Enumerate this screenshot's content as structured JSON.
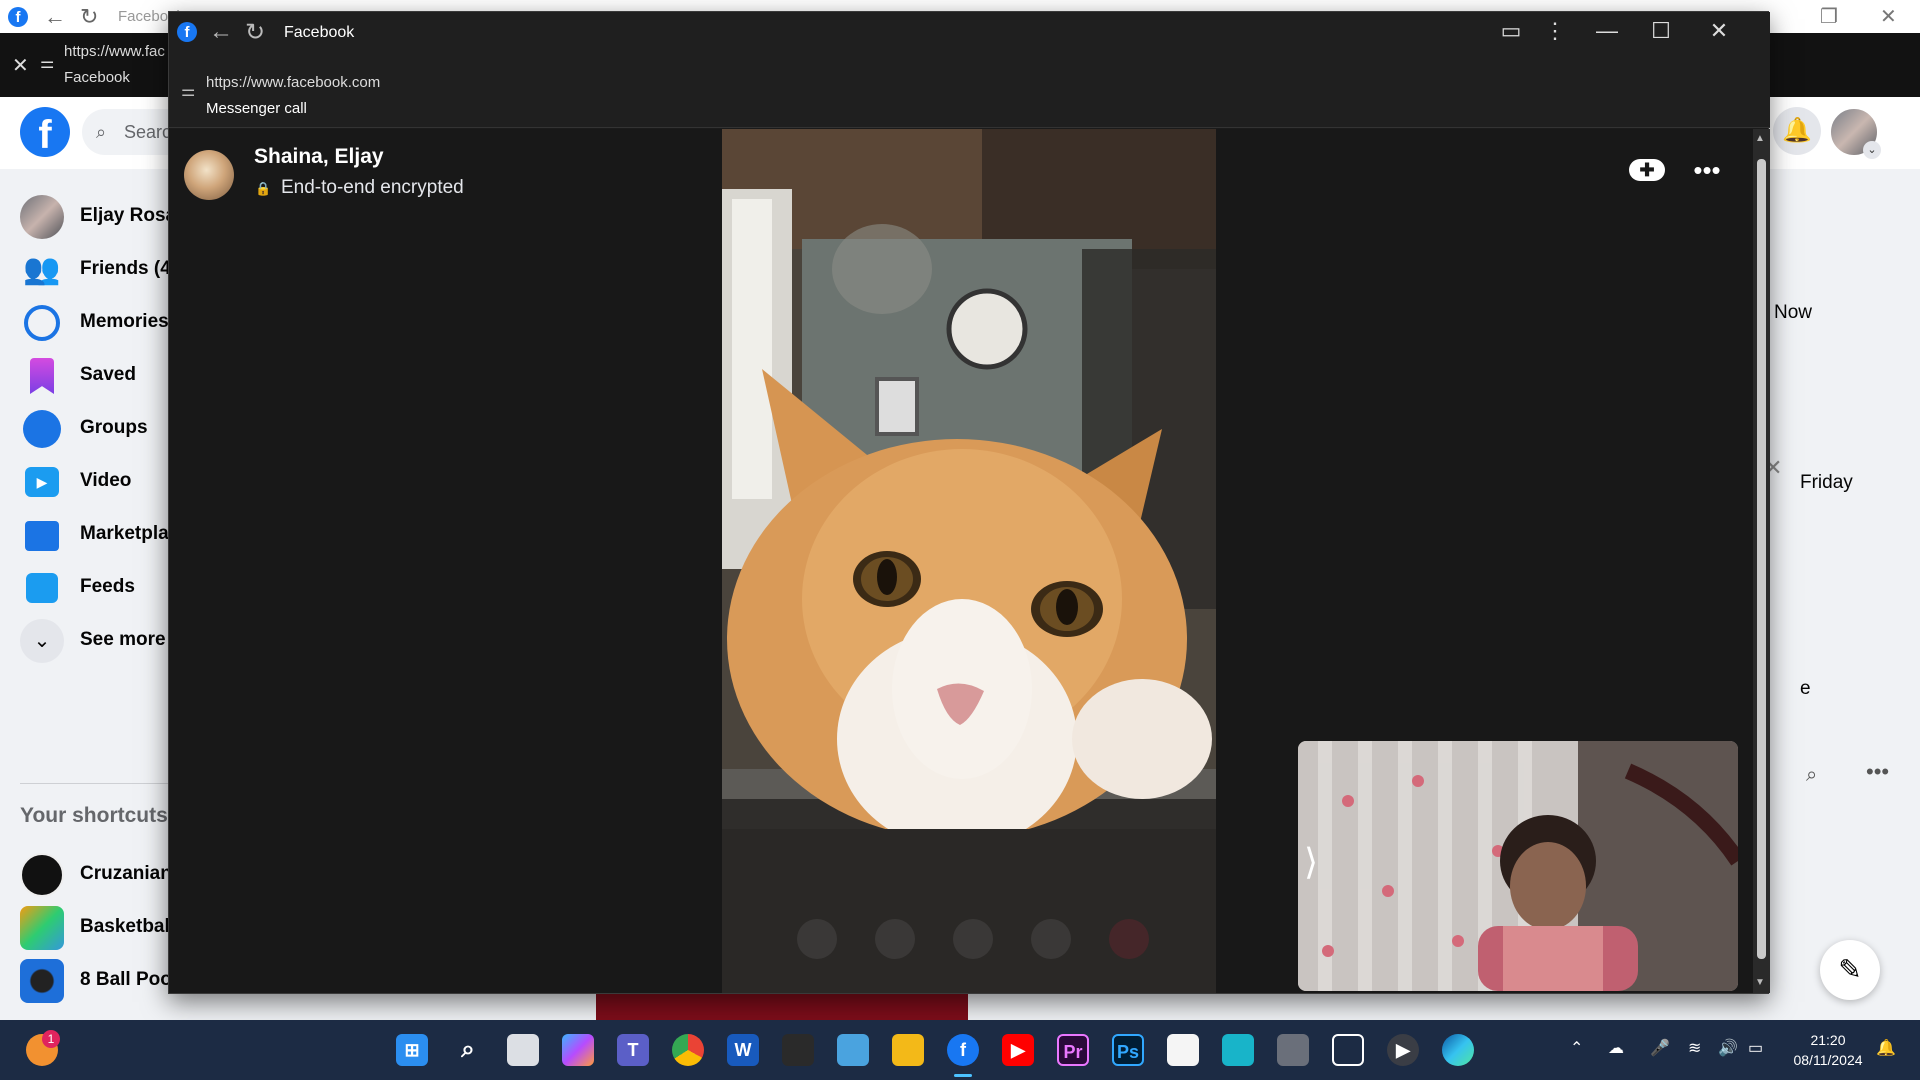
{
  "background_window": {
    "title": "Facebook",
    "url": "https://www.fac",
    "url_sub": "Facebook",
    "search_placeholder": "Searc",
    "sidebar": {
      "items": [
        {
          "label": "Eljay Rosal"
        },
        {
          "label": "Friends (44"
        },
        {
          "label": "Memories"
        },
        {
          "label": "Saved"
        },
        {
          "label": "Groups"
        },
        {
          "label": "Video"
        },
        {
          "label": "Marketplac"
        },
        {
          "label": "Feeds"
        },
        {
          "label": "See more"
        }
      ],
      "shortcuts_heading": "Your shortcuts",
      "shortcuts": [
        {
          "label": "Cruzanian"
        },
        {
          "label": "Basketball"
        },
        {
          "label": "8 Ball Pool"
        }
      ]
    },
    "right_column": {
      "now": "Now",
      "friday": "Friday",
      "e": "e"
    }
  },
  "call_window": {
    "title": "Facebook",
    "url": "https://www.facebook.com",
    "url_sub": "Messenger call",
    "caller_name": "Shaina, Eljay",
    "encryption_text": "End-to-end encrypted"
  },
  "taskbar": {
    "time": "21:20",
    "date": "08/11/2024",
    "notification_badge": "1"
  }
}
